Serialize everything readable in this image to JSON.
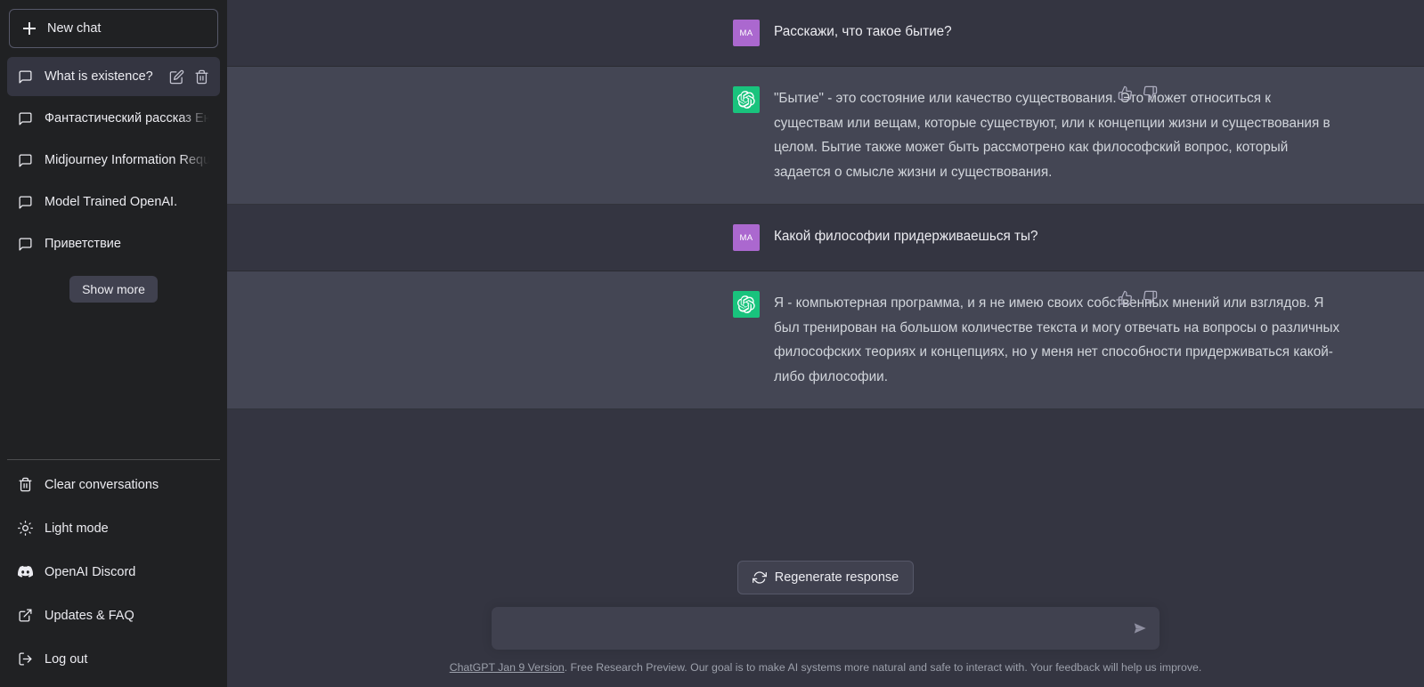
{
  "sidebar": {
    "new_chat_label": "New chat",
    "chats": [
      {
        "title": "What is existence?",
        "active": true
      },
      {
        "title": "Фантастический рассказ Енот",
        "active": false
      },
      {
        "title": "Midjourney Information Reque",
        "active": false
      },
      {
        "title": "Model Trained OpenAI.",
        "active": false
      },
      {
        "title": "Приветствие",
        "active": false
      }
    ],
    "show_more_label": "Show more",
    "footer_items": [
      {
        "label": "Clear conversations",
        "icon": "trash-icon"
      },
      {
        "label": "Light mode",
        "icon": "sun-icon"
      },
      {
        "label": "OpenAI Discord",
        "icon": "discord-icon"
      },
      {
        "label": "Updates & FAQ",
        "icon": "external-link-icon"
      },
      {
        "label": "Log out",
        "icon": "logout-icon"
      }
    ]
  },
  "conversation": {
    "user_avatar_initials": "MA",
    "messages": [
      {
        "role": "user",
        "text": "Расскажи, что такое бытие?"
      },
      {
        "role": "assistant",
        "text": "\"Бытие\" - это состояние или качество существования. Это может относиться к существам или вещам, которые существуют, или к концепции жизни и существования в целом. Бытие также может быть рассмотрено как философский вопрос, который задается о смысле жизни и существования."
      },
      {
        "role": "user",
        "text": "Какой философии придерживаешься ты?"
      },
      {
        "role": "assistant",
        "text": "Я - компьютерная программа, и я не имею своих собственных мнений или взглядов. Я был тренирован на большом количестве текста и могу отвечать на вопросы о различных философских теориях и концепциях, но у меня нет способности придерживаться какой-либо философии."
      }
    ]
  },
  "composer": {
    "regenerate_label": "Regenerate response",
    "input_value": "",
    "input_placeholder": ""
  },
  "footer": {
    "version_link": "ChatGPT Jan 9 Version",
    "disclaimer": ". Free Research Preview. Our goal is to make AI systems more natural and safe to interact with. Your feedback will help us improve."
  },
  "colors": {
    "sidebar_bg": "#202123",
    "user_msg_bg": "#343541",
    "assistant_msg_bg": "#444654",
    "user_avatar": "#ab68cf",
    "bot_avatar": "#19c37d",
    "composer_bg": "#40414f"
  }
}
